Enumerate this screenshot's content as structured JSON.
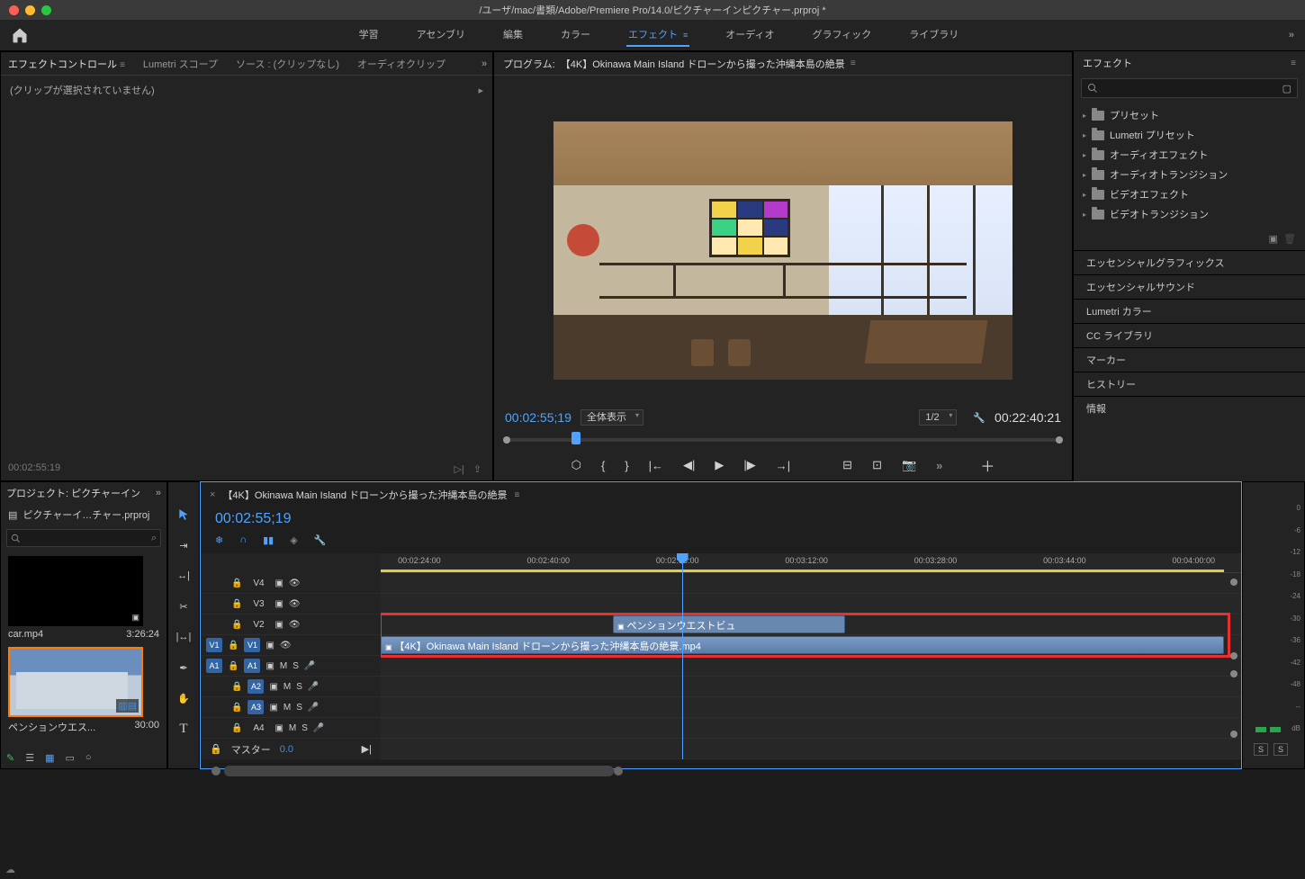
{
  "title": "/ユーザ/mac/書類/Adobe/Premiere Pro/14.0/ピクチャーインピクチャー.prproj *",
  "workspaces": [
    "学習",
    "アセンブリ",
    "編集",
    "カラー",
    "エフェクト",
    "オーディオ",
    "グラフィック",
    "ライブラリ"
  ],
  "workspace_active_index": 4,
  "effect_controls": {
    "tabs": [
      "エフェクトコントロール",
      "Lumetri スコープ",
      "ソース : (クリップなし)",
      "オーディオクリップ"
    ],
    "active_tab": 0,
    "no_clip": "(クリップが選択されていません)",
    "timecode": "00:02:55:19"
  },
  "program": {
    "label": "プログラム:",
    "title": "【4K】Okinawa Main Island ドローンから撮った沖縄本島の絶景",
    "timecode_left": "00:02:55;19",
    "fit_label": "全体表示",
    "scale_label": "1/2",
    "timecode_right": "00:22:40:21"
  },
  "effects_panel": {
    "title": "エフェクト",
    "search_placeholder": "",
    "folders": [
      "プリセット",
      "Lumetri プリセット",
      "オーディオエフェクト",
      "オーディオトランジション",
      "ビデオエフェクト",
      "ビデオトランジション"
    ]
  },
  "side_panels": [
    "エッセンシャルグラフィックス",
    "エッセンシャルサウンド",
    "Lumetri カラー",
    "CC ライブラリ",
    "マーカー",
    "ヒストリー",
    "情報"
  ],
  "project": {
    "title": "プロジェクト: ピクチャーイン",
    "file": "ピクチャーイ…チャー.prproj",
    "bins": [
      {
        "name": "car.mp4",
        "duration": "3:26:24",
        "selected": false,
        "type": "dark"
      },
      {
        "name": "ペンションウエス...",
        "duration": "30:00",
        "selected": true,
        "type": "house"
      }
    ]
  },
  "timeline": {
    "title": "【4K】Okinawa Main Island ドローンから撮った沖縄本島の絶景",
    "timecode": "00:02:55;19",
    "ruler_ticks": [
      "00:02:24:00",
      "00:02:40:00",
      "00:02:56:00",
      "00:03:12:00",
      "00:03:28:00",
      "00:03:44:00",
      "00:04:00:00"
    ],
    "video_tracks": [
      "V4",
      "V3",
      "V2",
      "V1"
    ],
    "audio_tracks": [
      "A1",
      "A2",
      "A3",
      "A4"
    ],
    "master_label": "マスター",
    "master_value": "0.0",
    "clip_v2": "ペンションウエストビュ",
    "clip_v1": "【4K】Okinawa Main Island ドローンから撮った沖縄本島の絶景.mp4",
    "src_patches": {
      "V1": "V1",
      "A1": "A1"
    }
  },
  "meter_scale": [
    "0",
    "-6",
    "-12",
    "-18",
    "-24",
    "-30",
    "-36",
    "-42",
    "-48",
    "--",
    "dB"
  ]
}
